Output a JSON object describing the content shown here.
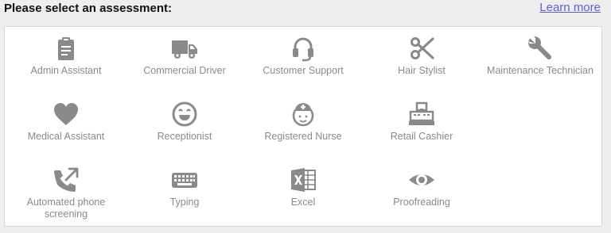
{
  "header": {
    "title": "Please select an assessment:",
    "learn_more": "Learn more"
  },
  "colors": {
    "icon": "#8a8a8a",
    "label": "#8a8a8a",
    "link": "#5f5fcf",
    "background": "#eeeeee",
    "panel": "#ffffff"
  },
  "assessments": [
    {
      "label": "Admin Assistant",
      "icon": "clipboard-icon"
    },
    {
      "label": "Commercial Driver",
      "icon": "truck-icon"
    },
    {
      "label": "Customer Support",
      "icon": "headset-icon"
    },
    {
      "label": "Hair Stylist",
      "icon": "scissors-icon"
    },
    {
      "label": "Maintenance Technician",
      "icon": "wrench-icon"
    },
    {
      "label": "Medical Assistant",
      "icon": "heart-icon"
    },
    {
      "label": "Receptionist",
      "icon": "smiley-icon"
    },
    {
      "label": "Registered Nurse",
      "icon": "nurse-icon"
    },
    {
      "label": "Retail Cashier",
      "icon": "cash-register-icon"
    },
    {
      "label": "Automated phone screening",
      "icon": "phone-outgoing-icon"
    },
    {
      "label": "Typing",
      "icon": "keyboard-icon"
    },
    {
      "label": "Excel",
      "icon": "excel-icon"
    },
    {
      "label": "Proofreading",
      "icon": "eye-icon"
    }
  ]
}
